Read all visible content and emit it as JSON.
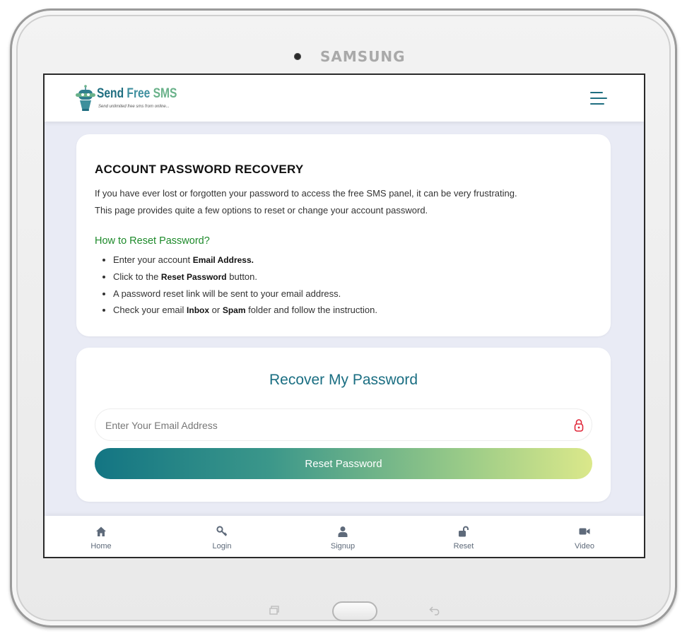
{
  "device": {
    "brand": "SAMSUNG"
  },
  "header": {
    "logo_send": "Send",
    "logo_free": "Free",
    "logo_sms": "SMS",
    "logo_tagline": "Send unlimited free sms from online..."
  },
  "info": {
    "title": "ACCOUNT PASSWORD RECOVERY",
    "paragraph_line1": "If you have ever lost or forgotten your password to access the free SMS panel, it can be very frustrating.",
    "paragraph_line2": "This page provides quite a few options to reset or change your account password.",
    "howto_title": "How to Reset Password?",
    "steps": [
      {
        "pre": "Enter your account ",
        "b1": "Email Address.",
        "mid": "",
        "b2": "",
        "post": ""
      },
      {
        "pre": "Click to the ",
        "b1": "Reset Password",
        "mid": " button.",
        "b2": "",
        "post": ""
      },
      {
        "pre": "A password reset link will be sent to your email address.",
        "b1": "",
        "mid": "",
        "b2": "",
        "post": ""
      },
      {
        "pre": "Check your email ",
        "b1": "Inbox",
        "mid": " or ",
        "b2": "Spam",
        "post": " folder and follow the instruction."
      }
    ]
  },
  "form": {
    "title": "Recover My Password",
    "email_placeholder": "Enter Your Email Address",
    "email_value": "",
    "reset_label": "Reset Password"
  },
  "nav": [
    {
      "label": "Home",
      "icon": "home-icon"
    },
    {
      "label": "Login",
      "icon": "key-icon"
    },
    {
      "label": "Signup",
      "icon": "user-icon"
    },
    {
      "label": "Reset",
      "icon": "unlock-icon"
    },
    {
      "label": "Video",
      "icon": "video-icon"
    }
  ],
  "colors": {
    "brand_teal": "#1a6e82",
    "howto_green": "#1d8a2a",
    "lock_red": "#e0283a",
    "screen_bg": "#e9ebf5",
    "nav_icon": "#5e6a7a"
  }
}
